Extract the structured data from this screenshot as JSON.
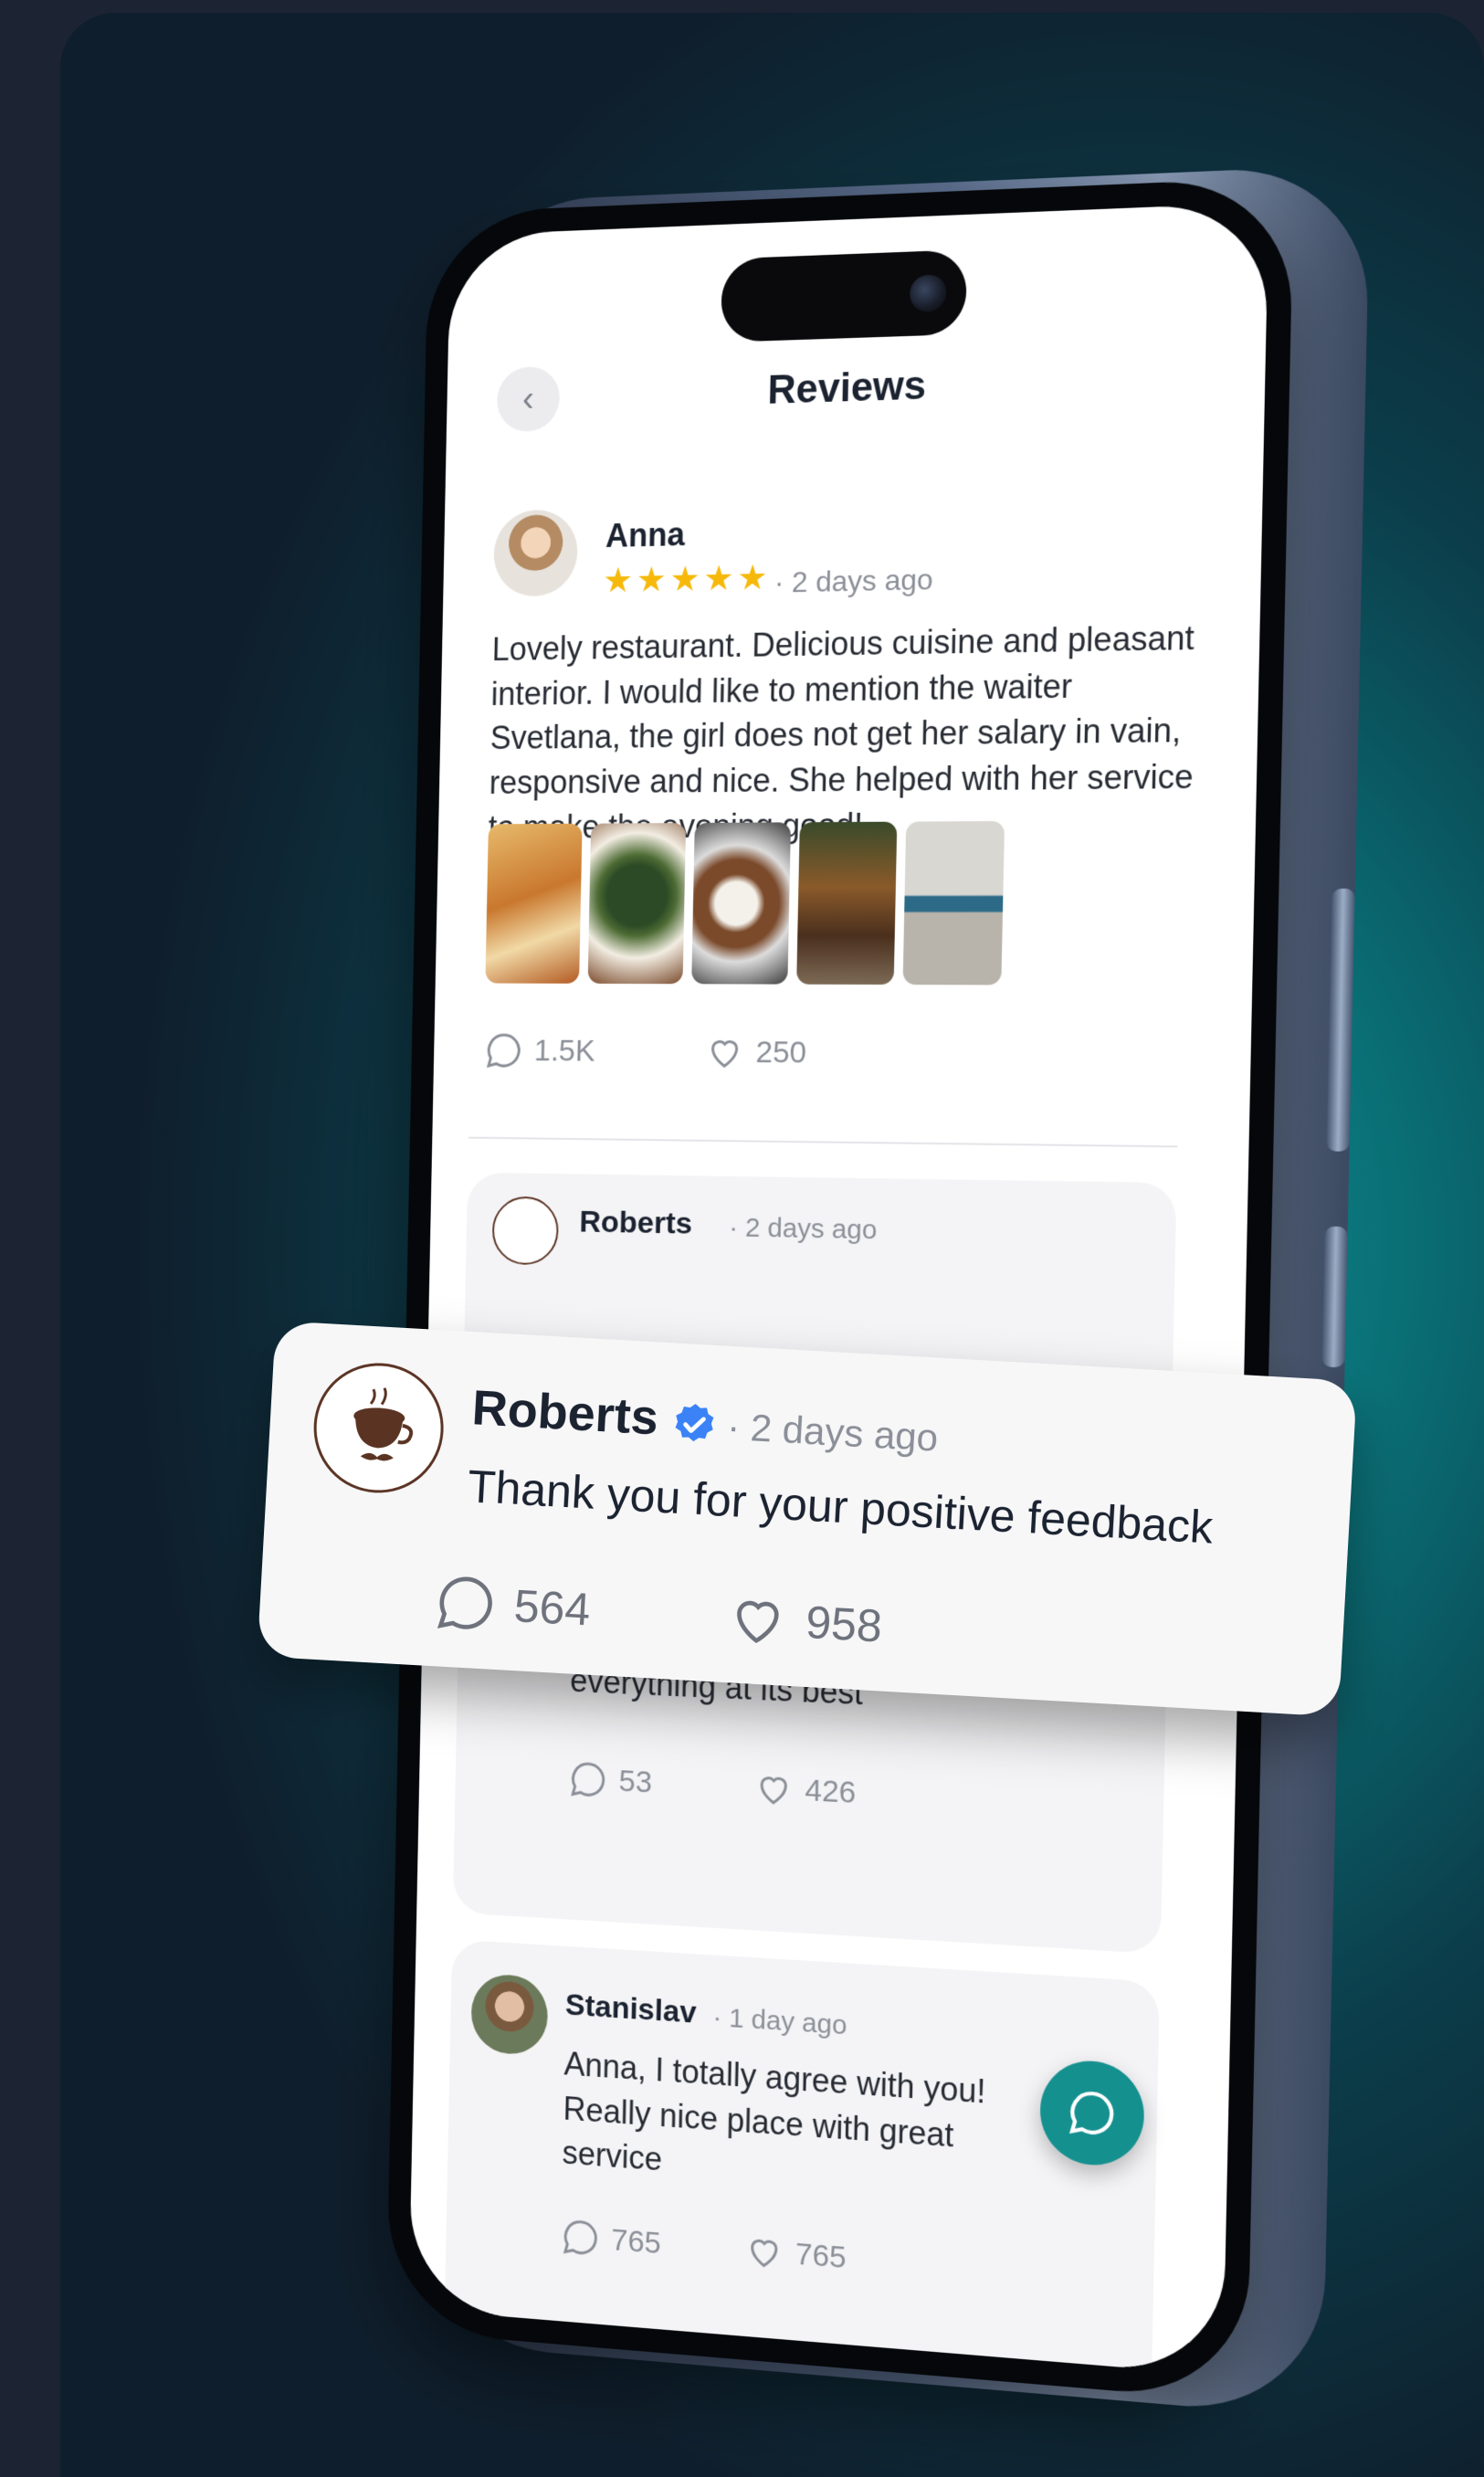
{
  "screen": {
    "title": "Reviews",
    "back_icon": "chevron-left-icon"
  },
  "reviews": [
    {
      "author": "Anna",
      "rating": 5,
      "stars": "★★★★★",
      "time": "· 2 days ago",
      "text": "Lovely restaurant. Delicious cuisine and pleasant interior. I would like to mention the waiter Svetlana, the girl does not get her salary in vain, responsive and nice. She helped with her service to make the evening good!",
      "comments": "1.5K",
      "likes": "250",
      "photos": [
        "noodle-dish-photo",
        "salad-dish-photo",
        "rice-dish-photo",
        "restaurant-interior-photo",
        "restaurant-exterior-photo"
      ]
    },
    {
      "author": "Roberts",
      "time": "· 2 days ago"
    },
    {
      "text": "According to, it's delicious there! Been there several times and always had everything at its best",
      "comments": "53",
      "likes": "426"
    },
    {
      "author": "Stanislav",
      "time": "· 1 day ago",
      "text": "Anna, I totally agree with you! Really nice place with great service",
      "comments": "765",
      "likes": "765"
    }
  ],
  "highlight_reply": {
    "author": "Roberts",
    "verified": true,
    "time": "· 2 days ago",
    "text": "Thank you for your positive feedback",
    "comments": "564",
    "likes": "958",
    "logo_text": "Roberts"
  },
  "fab_icon": "chat-bubble-icon",
  "colors": {
    "accent": "#14908f",
    "star": "#f6b90b",
    "verified": "#3b82f6"
  }
}
